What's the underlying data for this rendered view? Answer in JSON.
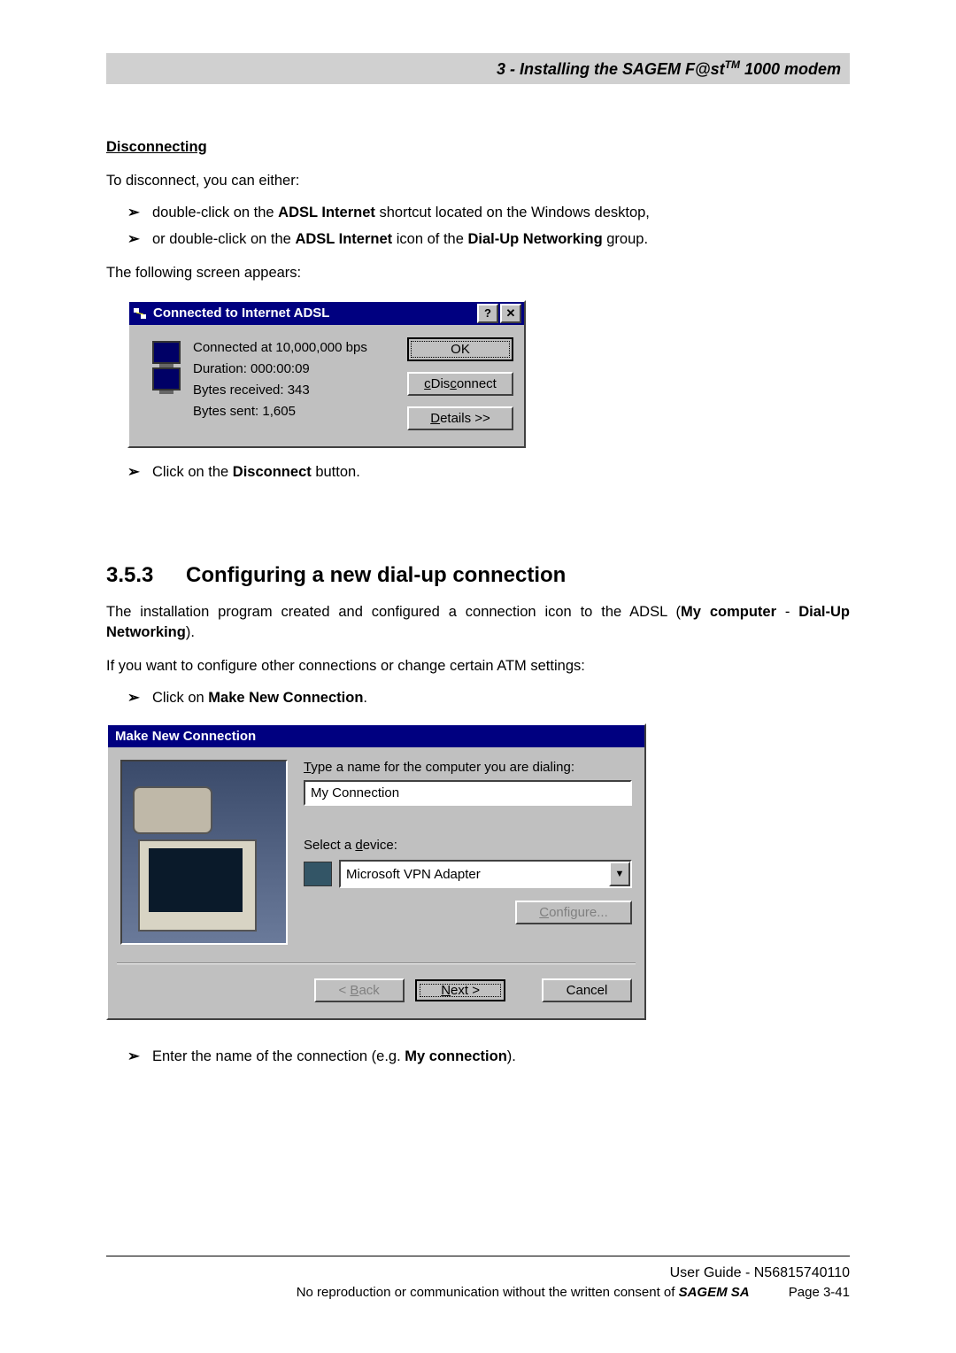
{
  "header": {
    "text_prefix": "3 - Installing the SAGEM F@st",
    "tm": "TM",
    "text_suffix": " 1000 modem"
  },
  "disconnecting": {
    "heading": "Disconnecting",
    "intro": "To disconnect, you can either:",
    "bullet1_pre": "double-click on the ",
    "bullet1_bold": "ADSL Internet",
    "bullet1_post": " shortcut located on the Windows desktop,",
    "bullet2_pre": "or double-click on the ",
    "bullet2_bold1": "ADSL Internet",
    "bullet2_mid": " icon of the ",
    "bullet2_bold2": "Dial-Up Networking",
    "bullet2_post": " group.",
    "following": "The following screen appears:",
    "click_disconnect_pre": "Click on the ",
    "click_disconnect_bold": "Disconnect",
    "click_disconnect_post": " button."
  },
  "connected_dialog": {
    "title": "Connected to Internet ADSL",
    "help_btn": "?",
    "close_btn": "✕",
    "line1": "Connected at 10,000,000 bps",
    "line2": "Duration: 000:00:09",
    "line3": "Bytes received: 343",
    "line4": "Bytes sent: 1,605",
    "ok": "OK",
    "disconnect": "Disconnect",
    "details_pre": "D",
    "details_post": "etails >>"
  },
  "section": {
    "number": "3.5.3",
    "title": "Configuring a new dial-up connection",
    "para1_pre": "The installation program created and configured a connection icon to the ADSL (",
    "para1_bold1": "My computer",
    "para1_mid": " - ",
    "para1_bold2": "Dial-Up Networking",
    "para1_post": ").",
    "para2": "If you want to configure other connections or change certain ATM settings:",
    "bullet_pre": "Click on ",
    "bullet_bold": "Make New Connection",
    "bullet_post": "."
  },
  "wizard": {
    "title": "Make New Connection",
    "label_type_pre": "T",
    "label_type_post": "ype a name for the computer you are dialing:",
    "name_value": "My Connection",
    "label_device_pre": "Select a ",
    "label_device_u": "d",
    "label_device_post": "evice:",
    "device_value": "Microsoft VPN Adapter",
    "dropdown_glyph": "▼",
    "configure_pre": "C",
    "configure_post": "onfigure...",
    "back_pre": "< ",
    "back_u": "B",
    "back_post": "ack",
    "next_u": "N",
    "next_post": "ext >",
    "cancel": "Cancel"
  },
  "after_wizard": {
    "bullet_pre": "Enter the name of the connection (e.g. ",
    "bullet_bold": "My connection",
    "bullet_post": ")."
  },
  "footer": {
    "line1": "User Guide - N56815740110",
    "line2_pre": "No reproduction or communication without the written consent of ",
    "line2_bold": "SAGEM SA",
    "page": "Page 3-41"
  },
  "glyphs": {
    "tri": "➢"
  }
}
